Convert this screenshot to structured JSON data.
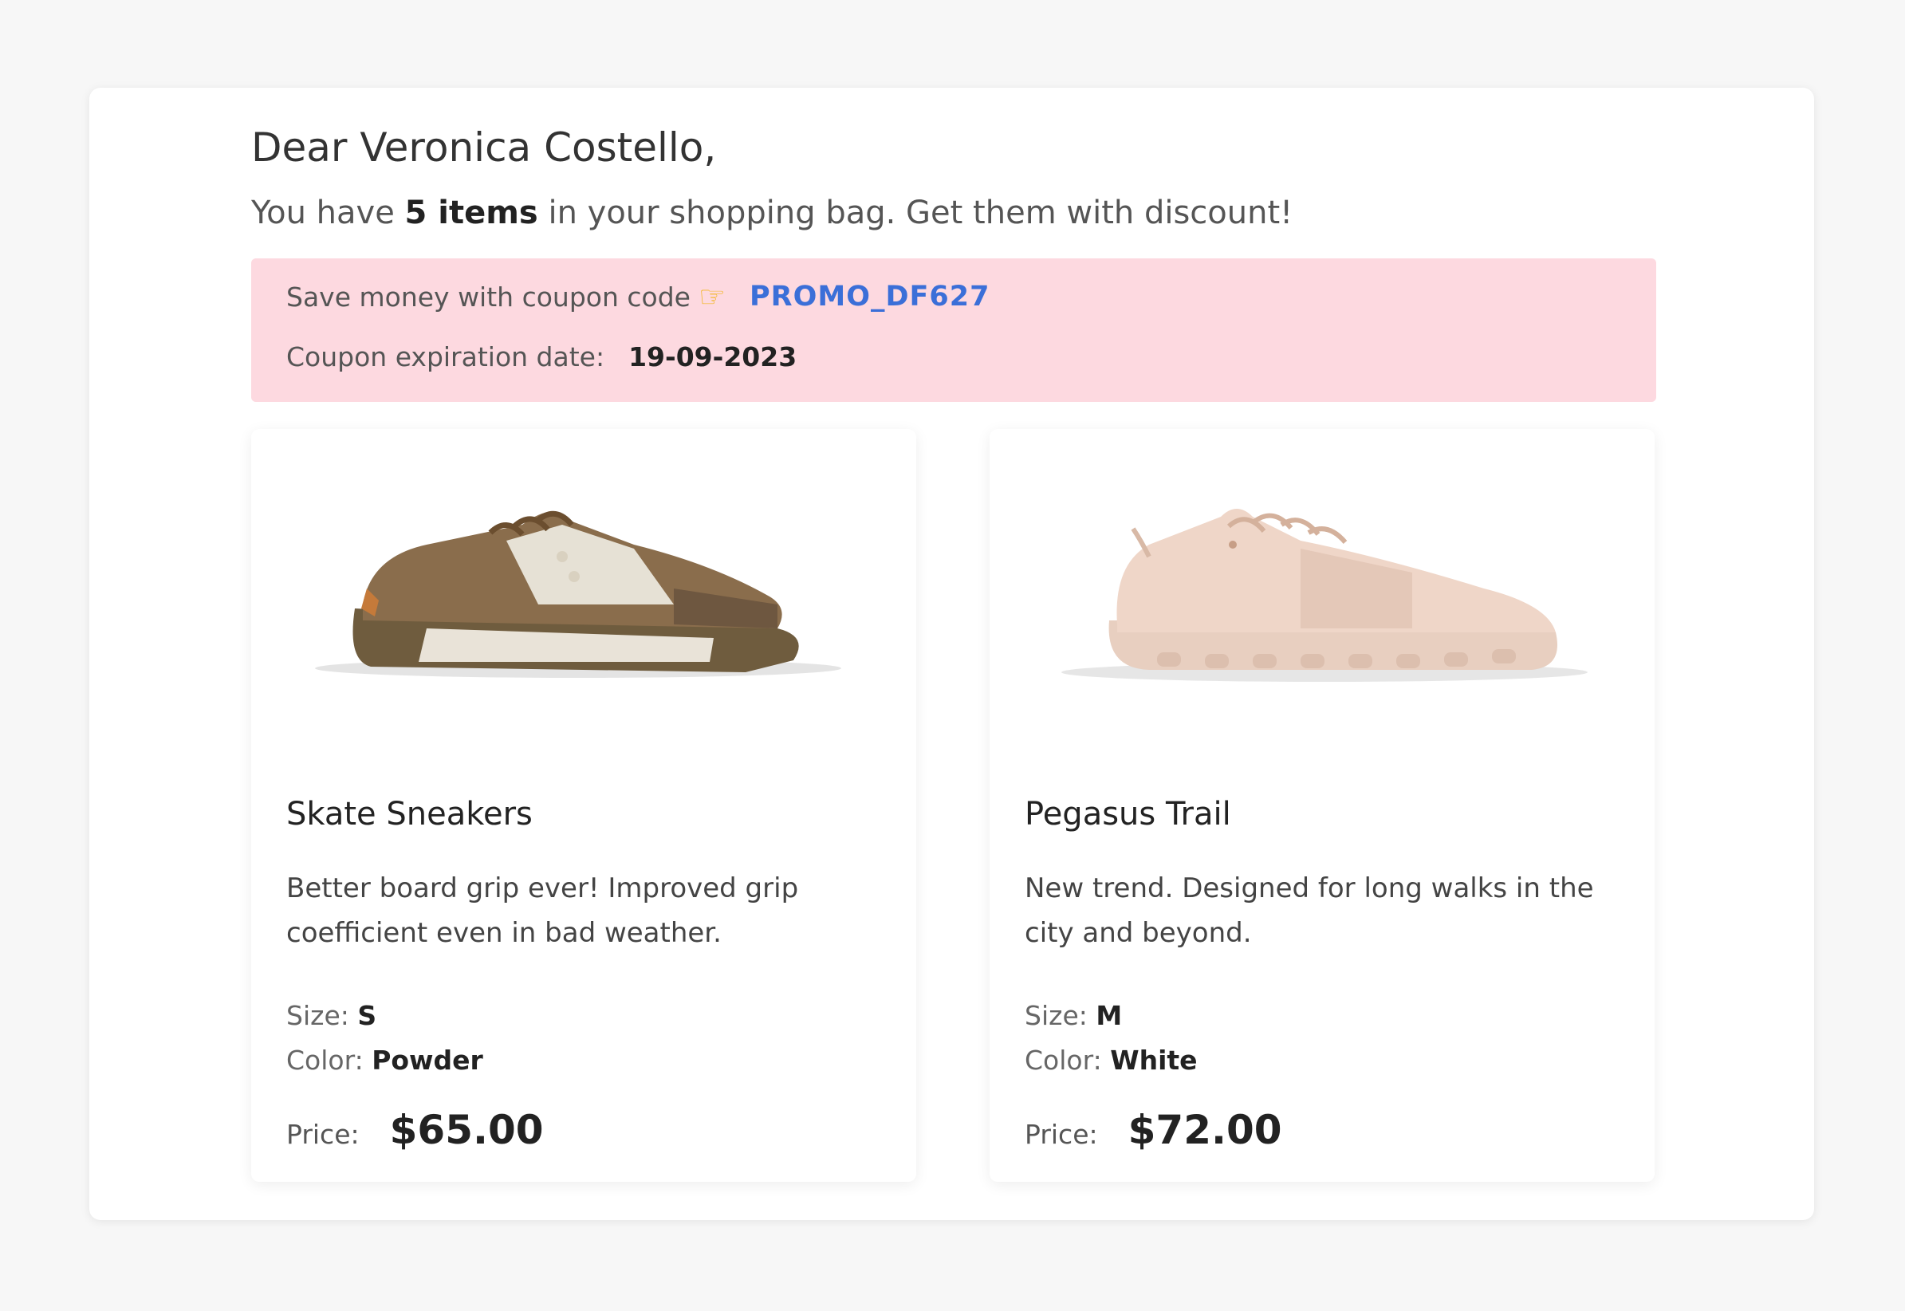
{
  "greeting": "Dear Veronica Costello,",
  "intro": {
    "before": "You have ",
    "count": "5 items",
    "after": " in your shopping bag. Get them with discount!"
  },
  "coupon": {
    "label": "Save money with coupon code",
    "icon": "pointing-hand-icon",
    "code": "PROMO_DF627",
    "expiration_label": "Coupon expiration date:",
    "expiration_date": "19-09-2023",
    "background_color": "#fdd9e0",
    "code_color": "#3b6fd8"
  },
  "products": [
    {
      "name": "Skate Sneakers",
      "description": "Better board grip ever! Improved grip coefficient even in bad weather.",
      "size_label": "Size:",
      "size": "S",
      "color_label": "Color:",
      "color": "Powder",
      "price_label": "Price:",
      "price": "$65.00"
    },
    {
      "name": "Pegasus Trail",
      "description": "New trend. Designed for long walks in the city and beyond.",
      "size_label": "Size:",
      "size": "M",
      "color_label": "Color:",
      "color": "White",
      "price_label": "Price:",
      "price": "$72.00"
    }
  ]
}
